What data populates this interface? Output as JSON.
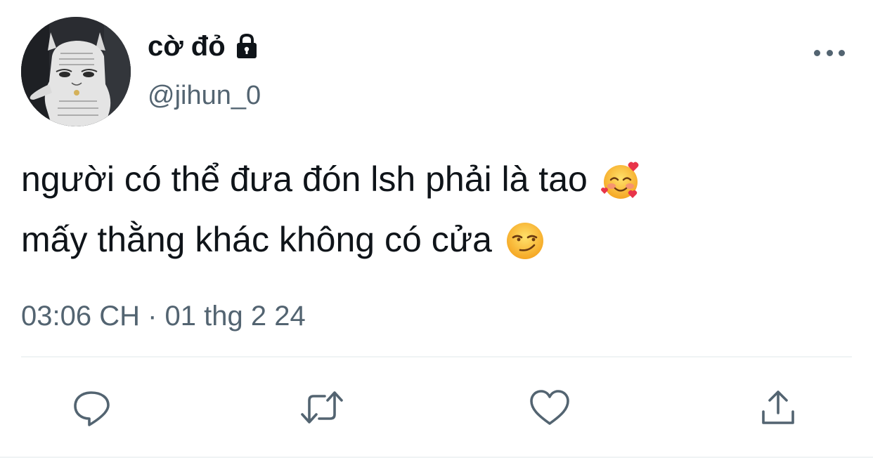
{
  "user": {
    "display_name": "cờ đỏ",
    "handle": "@jihun_0",
    "protected_icon": "lock-icon",
    "avatar_icon": "cat-avatar"
  },
  "tweet": {
    "lines": [
      {
        "text": "người có thể đưa đón lsh phải là tao",
        "emoji": "smiling-face-with-hearts"
      },
      {
        "text": "mấy thằng khác không có cửa",
        "emoji": "smirking-face"
      }
    ],
    "timestamp": "03:06 CH · 01 thg 2 24"
  },
  "actions": [
    {
      "name": "reply",
      "icon": "reply-icon"
    },
    {
      "name": "retweet",
      "icon": "retweet-icon"
    },
    {
      "name": "like",
      "icon": "heart-icon"
    },
    {
      "name": "share",
      "icon": "share-icon"
    }
  ],
  "colors": {
    "text_primary": "#0f1419",
    "text_secondary": "#536471",
    "divider": "#eff3f4",
    "background": "#ffffff"
  }
}
